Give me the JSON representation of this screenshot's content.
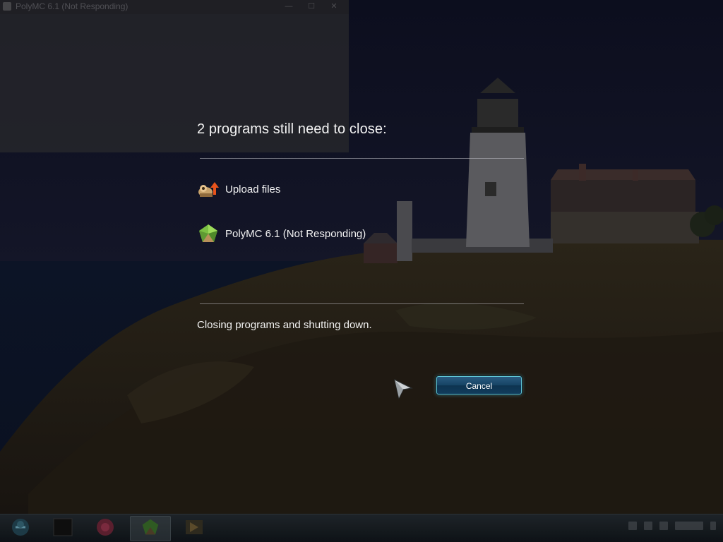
{
  "background_window": {
    "title": "PolyMC 6.1 (Not Responding)"
  },
  "shutdown_dialog": {
    "heading": "2 programs still need to close:",
    "programs": [
      {
        "label": "Upload files",
        "icon": "upload-files-icon"
      },
      {
        "label": "PolyMC 6.1 (Not Responding)",
        "icon": "polymc-icon"
      }
    ],
    "status": "Closing programs and shutting down.",
    "cancel_label": "Cancel"
  },
  "taskbar": {
    "items": [
      {
        "icon": "start-orb-icon"
      },
      {
        "icon": "terminal-icon"
      },
      {
        "icon": "browser-icon"
      },
      {
        "icon": "polymc-icon",
        "active": true
      },
      {
        "icon": "media-icon"
      }
    ]
  },
  "colors": {
    "accent_cyan": "#5fc5d6",
    "button_blue": "#174566",
    "text": "#f2f2f2"
  }
}
